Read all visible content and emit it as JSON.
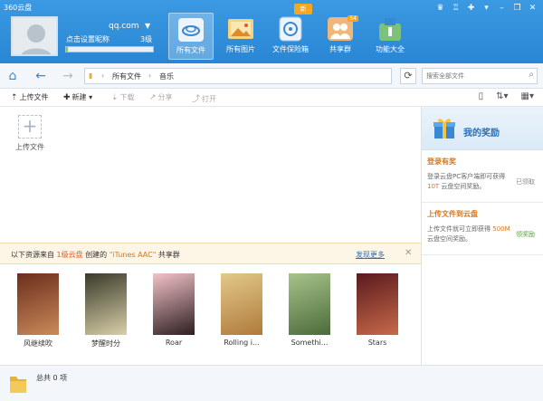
{
  "app": {
    "title": "360云盘"
  },
  "window_controls": [
    "♛",
    "♖",
    "✚",
    "▾",
    "–",
    "❐",
    "✕"
  ],
  "user": {
    "account": "qq.com",
    "nickname": "点击设置昵称",
    "level": "3级",
    "storage_used": 0.02
  },
  "nav": {
    "new_badge": "新",
    "items": [
      {
        "label": "所有文件",
        "icon": "cloud-icon",
        "active": true
      },
      {
        "label": "所有图片",
        "icon": "picture-icon",
        "active": false
      },
      {
        "label": "文件保险箱",
        "icon": "safe-icon",
        "active": false
      },
      {
        "label": "共享群",
        "icon": "share-group-icon",
        "active": false,
        "badge": "54"
      },
      {
        "label": "功能大全",
        "icon": "toolbox-icon",
        "active": false
      }
    ]
  },
  "address": {
    "breadcrumb": [
      "所有文件",
      "音乐"
    ],
    "search_placeholder": "搜索全部文件"
  },
  "toolbar": {
    "upload": "上传文件",
    "new": "新建",
    "download": "下载",
    "share": "分享",
    "open": "打开"
  },
  "files": {
    "upload_tile_label": "上传文件"
  },
  "shared_panel": {
    "prefix": "以下资源来自",
    "source": "1级云盘",
    "created": "创建的",
    "group": "\"iTunes AAC\"",
    "suffix": "共享群",
    "discover": "发现更多",
    "albums": [
      {
        "title": "风继续吹",
        "colors": [
          "#6b2e1c",
          "#c98a5a"
        ]
      },
      {
        "title": "梦醒时分",
        "colors": [
          "#3a3a2a",
          "#d8cfa8"
        ]
      },
      {
        "title": "Roar",
        "colors": [
          "#f3c3c8",
          "#2c1e20"
        ]
      },
      {
        "title": "Rolling i...",
        "colors": [
          "#e2c98a",
          "#b07a3a"
        ]
      },
      {
        "title": "Somethi...",
        "colors": [
          "#a8c38a",
          "#4a6b3a"
        ]
      },
      {
        "title": "Stars",
        "colors": [
          "#5a1a1e",
          "#c86a4a"
        ]
      }
    ]
  },
  "rewards": {
    "title": "我的奖励",
    "items": [
      {
        "heading": "登录有奖",
        "desc_pre": "登录云盘PC客户端即可获得",
        "highlight": "10T",
        "desc_post": "云盘空间奖励。",
        "status": "已领取",
        "done": true
      },
      {
        "heading": "上传文件到云盘",
        "desc_pre": "上传文件就可立即获得",
        "highlight": "500M",
        "desc_post": "云盘空间奖励。",
        "status": "领奖励",
        "done": false
      }
    ]
  },
  "status": {
    "total": "总共 0 项"
  },
  "colors": {
    "header": "#2f8fd9",
    "accent_orange": "#d9771a",
    "link_blue": "#2a6fb5"
  }
}
